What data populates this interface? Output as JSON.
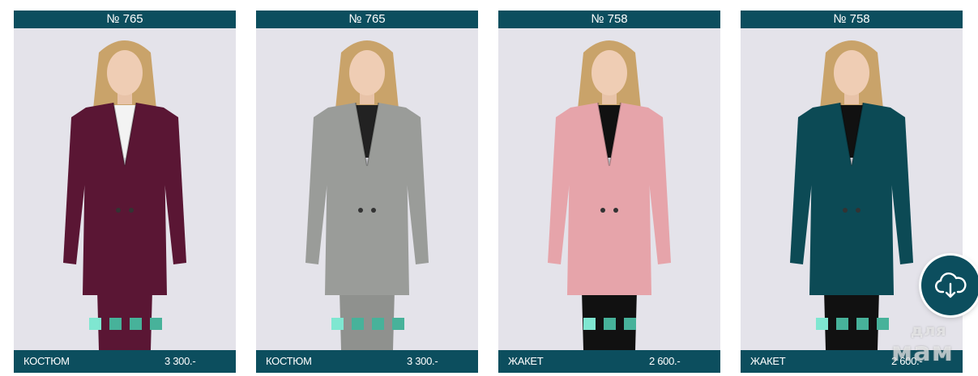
{
  "products": [
    {
      "number": "№ 765",
      "name": "КОСТЮМ",
      "price": "3 300.-",
      "color": "#5a1634",
      "inner": "#f3f3f3",
      "skirt": "#5a1634",
      "legs": "#5a1634",
      "thumbs": 4
    },
    {
      "number": "№ 765",
      "name": "КОСТЮМ",
      "price": "3 300.-",
      "color": "#9a9c99",
      "inner": "#222222",
      "skirt": "#8f918e",
      "legs": "#8f918e",
      "thumbs": 4
    },
    {
      "number": "№ 758",
      "name": "ЖАКЕТ",
      "price": "2 600.-",
      "color": "#e6a4aa",
      "inner": "#111111",
      "skirt": "#111111",
      "legs": "#111111",
      "thumbs": 3
    },
    {
      "number": "№ 758",
      "name": "ЖАКЕТ",
      "price": "2 600.-",
      "color": "#0c4a55",
      "inner": "#111111",
      "skirt": "#111111",
      "legs": "#111111",
      "thumbs": 4
    }
  ],
  "icons": {
    "download": "cloud-download-icon"
  },
  "watermark": {
    "line1": "для",
    "line2": "мам"
  }
}
